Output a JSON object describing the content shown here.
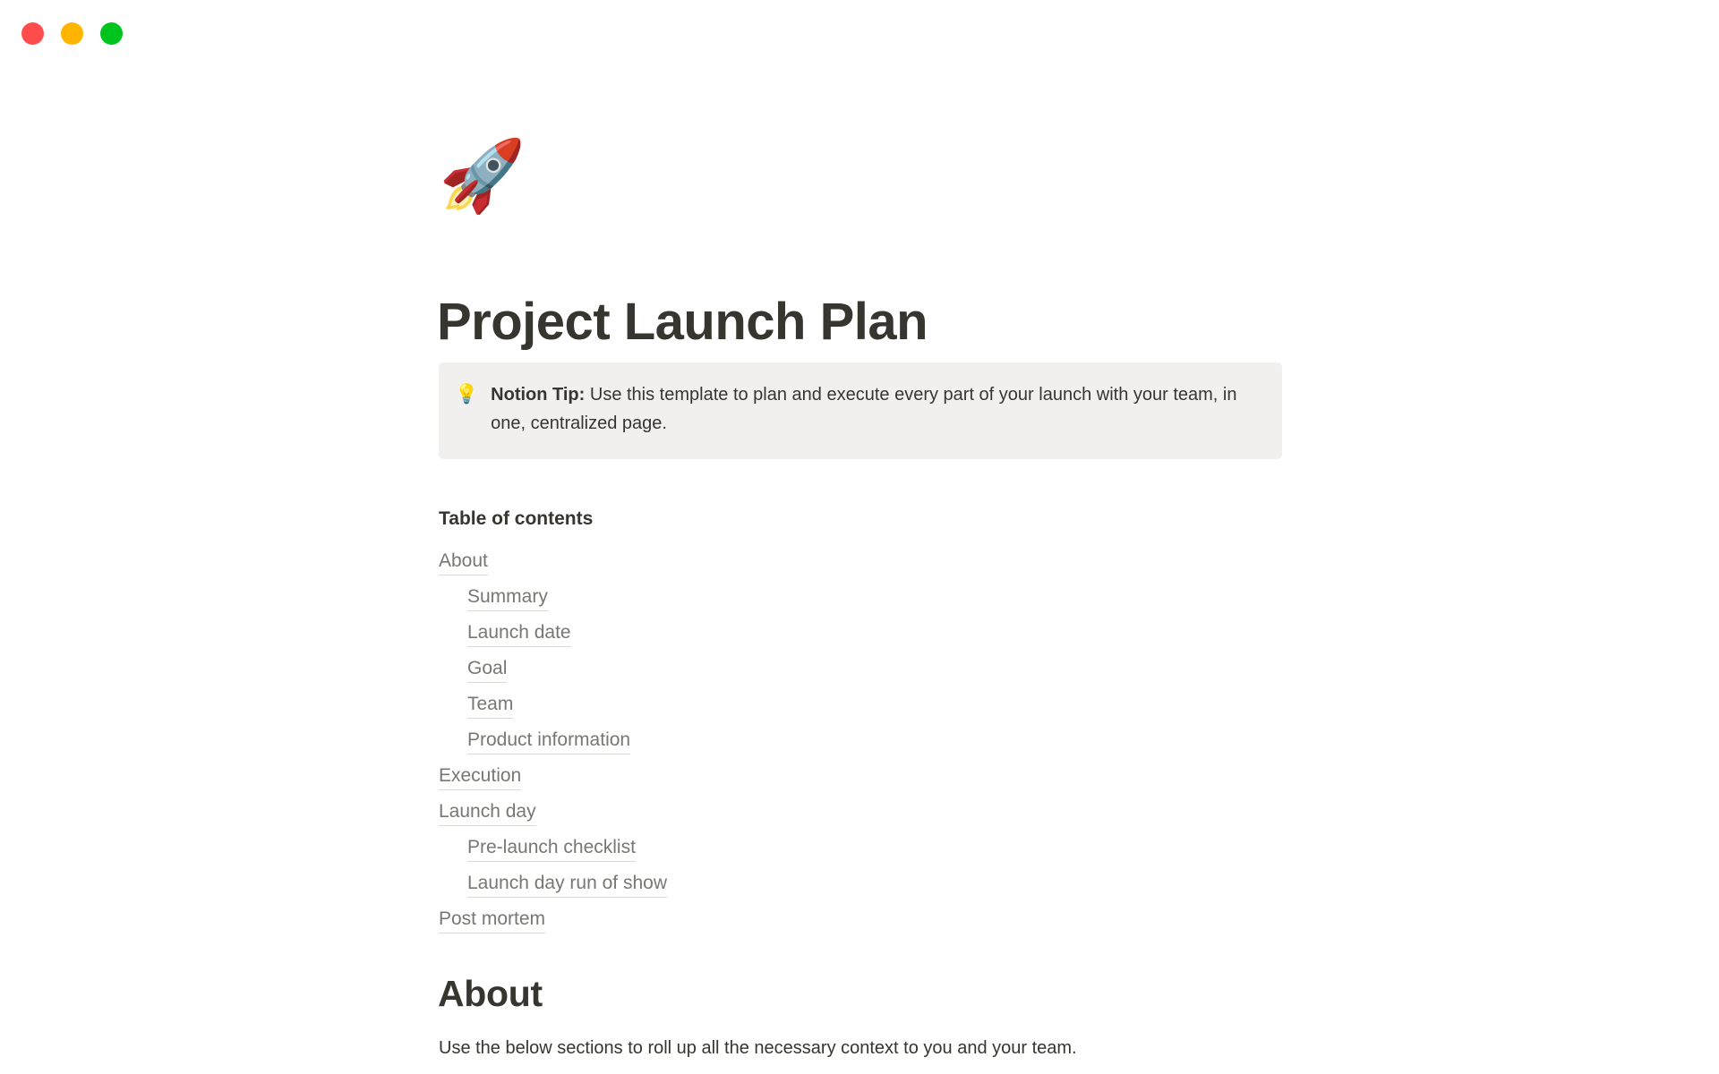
{
  "window": {
    "traffic_lights": [
      {
        "name": "close",
        "color": "#ff4d4d"
      },
      {
        "name": "minimize",
        "color": "#ffb400"
      },
      {
        "name": "maximize",
        "color": "#00c41e"
      }
    ]
  },
  "page": {
    "icon": "🚀",
    "title": "Project Launch Plan"
  },
  "callout": {
    "emoji": "💡",
    "label": "Notion Tip:",
    "text": " Use this template to plan and execute every part of your launch with your team, in one, centralized page."
  },
  "toc": {
    "heading": "Table of contents",
    "items": [
      {
        "label": "About",
        "level": 1
      },
      {
        "label": "Summary",
        "level": 2
      },
      {
        "label": "Launch date",
        "level": 2
      },
      {
        "label": "Goal",
        "level": 2
      },
      {
        "label": "Team",
        "level": 2
      },
      {
        "label": "Product information",
        "level": 2
      },
      {
        "label": "Execution",
        "level": 1
      },
      {
        "label": "Launch day",
        "level": 1
      },
      {
        "label": "Pre-launch checklist",
        "level": 2
      },
      {
        "label": "Launch day run of show",
        "level": 2
      },
      {
        "label": "Post mortem",
        "level": 1
      }
    ]
  },
  "about_section": {
    "heading": "About",
    "paragraph": "Use the below sections to roll up all the necessary context to you and your team."
  },
  "colors": {
    "text_primary": "#37352f",
    "text_muted": "#787774",
    "callout_bg": "#f1f0ee",
    "link_underline": "#d9d8d5",
    "page_bg": "#ffffff"
  }
}
